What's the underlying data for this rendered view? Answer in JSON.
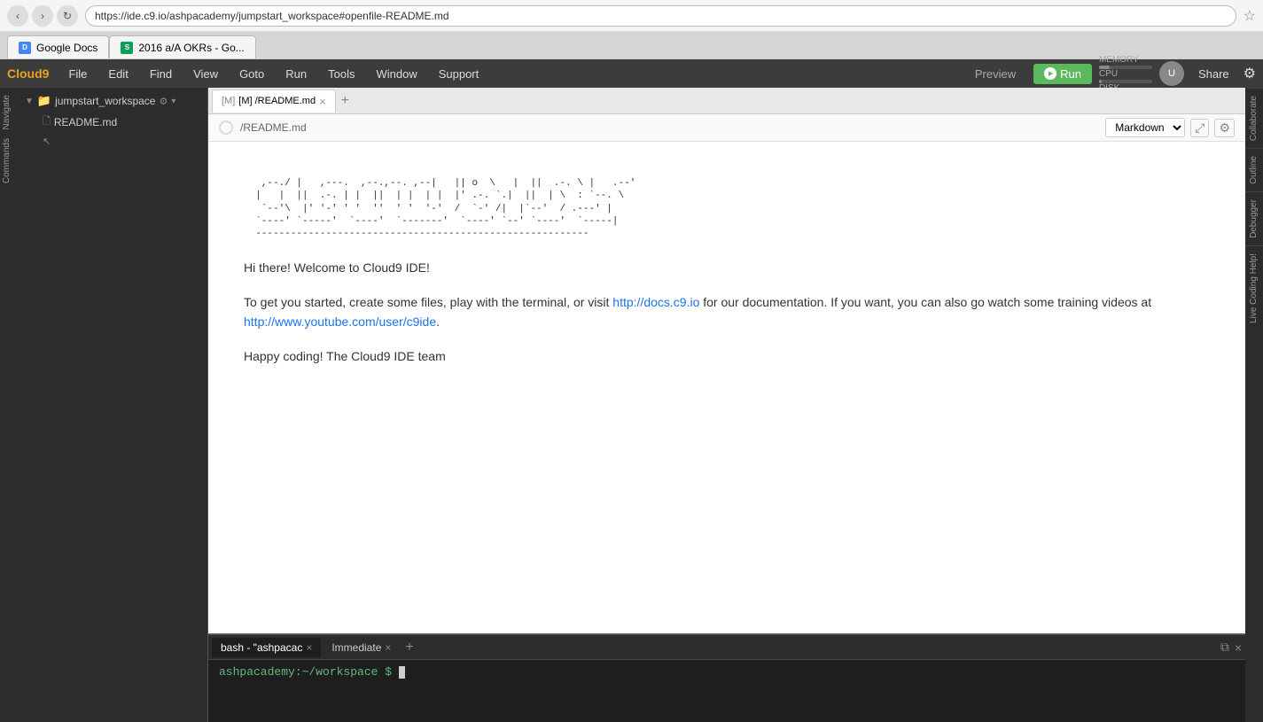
{
  "browser": {
    "url": "https://ide.c9.io/ashpacademy/jumpstart_workspace#openfile-README.md",
    "tabs": [
      {
        "label": "Google Docs",
        "favicon_text": "D",
        "favicon_color": "#4285f4",
        "active": false
      },
      {
        "label": "2016 a/A OKRs - Go...",
        "favicon_text": "S",
        "favicon_color": "#0f9d58",
        "active": false
      }
    ]
  },
  "menubar": {
    "logo": "Cloud9",
    "items": [
      "File",
      "Edit",
      "Find",
      "View",
      "Goto",
      "Run",
      "Tools",
      "Window",
      "Support"
    ],
    "preview_label": "Preview",
    "run_label": "Run",
    "share_label": "Share",
    "memory_label": "MEMORY",
    "cpu_label": "CPU",
    "disk_label": "DISK"
  },
  "sidebar": {
    "items": [
      "Navigate",
      "Commands"
    ]
  },
  "file_tree": {
    "workspace_name": "jumpstart_workspace",
    "files": [
      "README.md"
    ]
  },
  "editor": {
    "tabs": [
      {
        "label": "[M] /README.md",
        "icon": "M",
        "active": true
      }
    ],
    "add_tab_label": "+",
    "path": "/README.md",
    "markdown_selector": "Markdown",
    "ascii_art": "   ,--./ |   ,---.  ,--.,--. ,--|   || o  \\   |  ||  .-. \\ |   .--'\n  |   |  ||  .-. | |  ||  | |  | |  |' .-. `.|  ||  | \\  : `--. \\\n   `--'\\  |' '-' ' '  ''  ' '  '-'  /  `-' /|  |`--'  / .---' |\n  `----' `-----'  `----'  `-------'  `----' `--' `----'  `-----|",
    "separator": "--------------------------------------------------------",
    "paragraphs": [
      {
        "text_before": "Hi there! Welcome to Cloud9 IDE!",
        "type": "heading"
      },
      {
        "text_before": "To get you started, create some files, play with the terminal, or visit ",
        "link1_text": "http://docs.c9.io",
        "link1_url": "http://docs.c9.io",
        "text_middle": " for our documentation. If you want, you can also go watch some training videos at ",
        "link2_text": "http://www.youtube.com/user/c9ide",
        "link2_url": "http://www.youtube.com/user/c9ide",
        "text_after": ".",
        "type": "links"
      },
      {
        "text_before": "Happy coding! The Cloud9 IDE team",
        "type": "normal"
      }
    ]
  },
  "right_sidebar": {
    "items": [
      "Collaborate",
      "Outline",
      "Debugger",
      "Live Coding Help!"
    ]
  },
  "terminal": {
    "tabs": [
      {
        "label": "bash - \"ashpacac",
        "active": true
      },
      {
        "label": "Immediate",
        "active": false
      }
    ],
    "add_label": "+",
    "prompt": "ashpacademy:~/workspace",
    "prompt_symbol": "$"
  }
}
